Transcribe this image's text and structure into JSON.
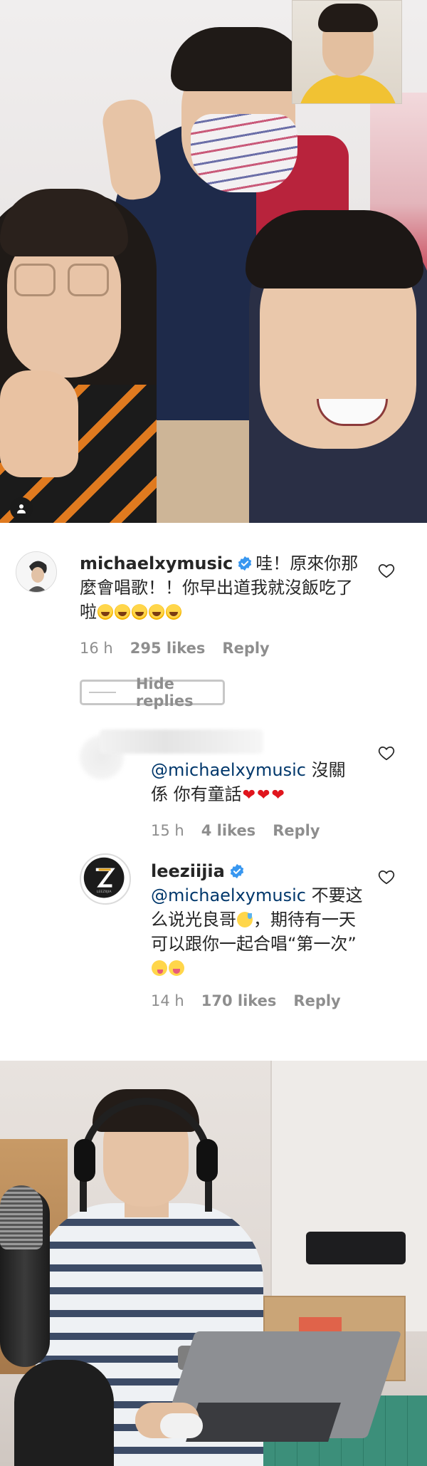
{
  "post_photo_top": {
    "user_tag_icon": "person-tag-icon"
  },
  "comments": [
    {
      "username": "michaelxymusic",
      "verified": true,
      "text": "哇！原來你那麼會唱歌！！你早出道我就沒飯吃了啦",
      "emojis": [
        "joy",
        "joy",
        "joy",
        "joy",
        "joy"
      ],
      "time": "16 h",
      "likes": "295 likes",
      "reply_label": "Reply"
    }
  ],
  "hide_replies_label": "Hide replies",
  "replies": [
    {
      "username": "",
      "username_blurred": true,
      "mention": "@michaelxymusic",
      "text": " 沒關係 你有童話",
      "emojis": [
        "heart",
        "heart",
        "heart"
      ],
      "time": "15 h",
      "likes": "4 likes",
      "reply_label": "Reply"
    },
    {
      "username": "leeziijia",
      "verified": true,
      "avatar_text": "LEEZIIJIA",
      "mention": "@michaelxymusic",
      "text_part1": " 不要这么说光良哥",
      "text_part2": "，期待有一天可以跟你一起合唱“第一次”",
      "emojis": [
        "sweat-smile",
        "zany",
        "squint-tongue"
      ],
      "time": "14 h",
      "likes": "170 likes",
      "reply_label": "Reply"
    }
  ],
  "icons": {
    "verified": "verified-badge-icon",
    "like": "heart-outline-icon"
  },
  "colors": {
    "verified_blue": "#3897f0",
    "mention_blue": "#00376b",
    "meta_gray": "#8e8e8e",
    "heart_red": "#e0151d"
  }
}
